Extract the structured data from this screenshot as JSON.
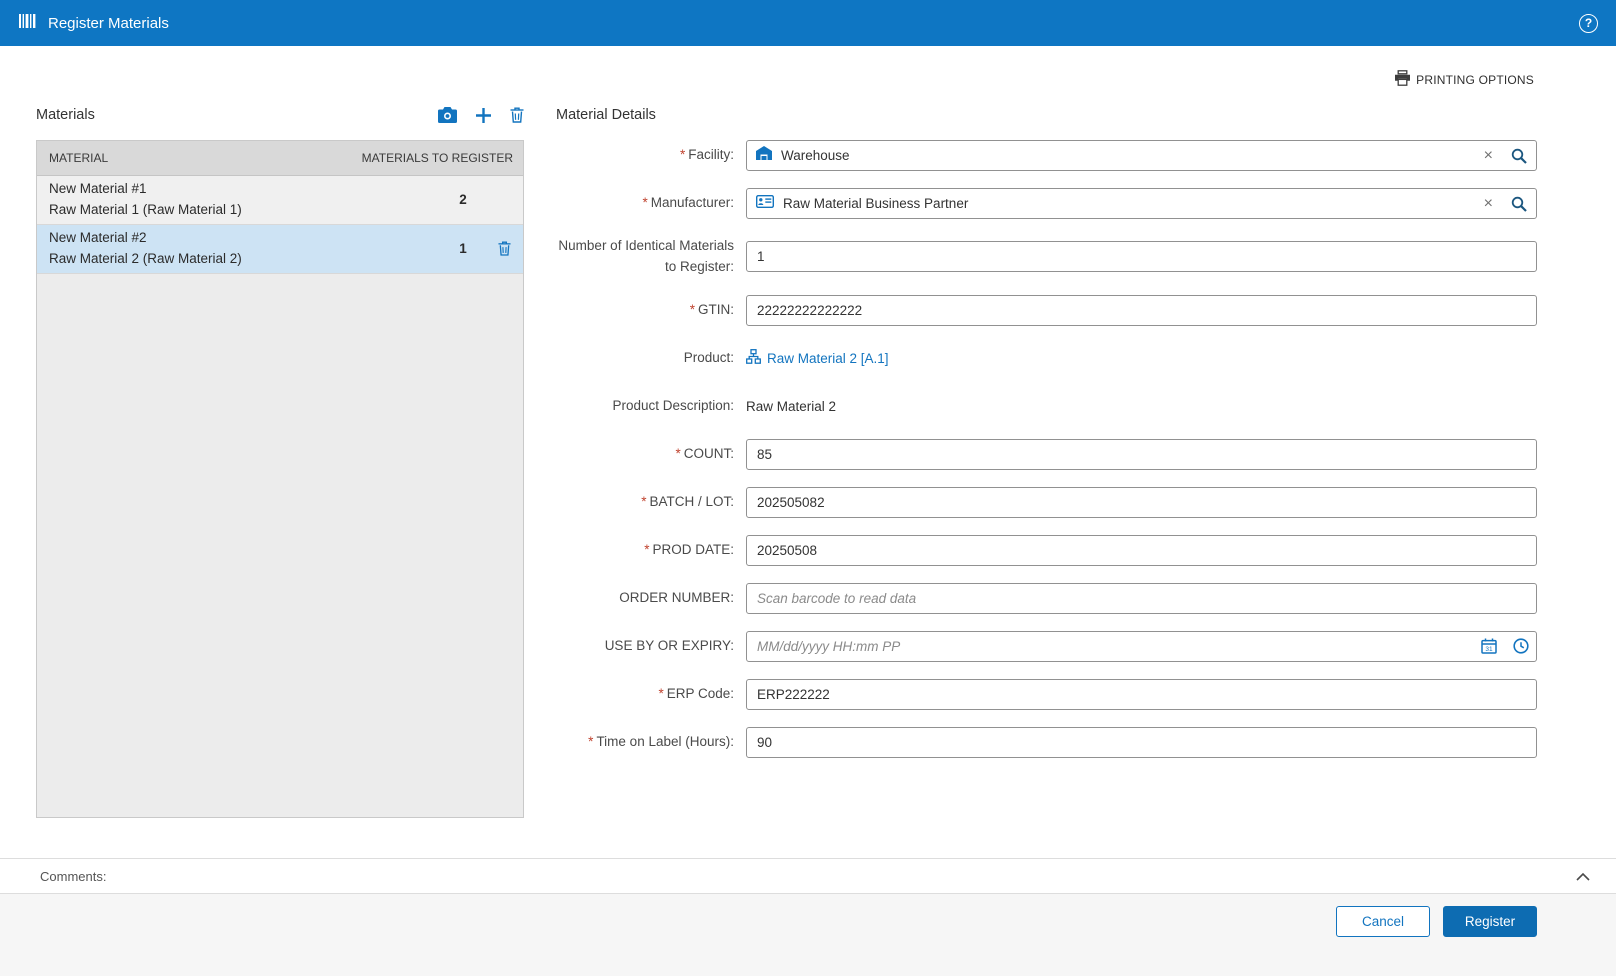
{
  "header": {
    "title": "Register Materials"
  },
  "icons": {
    "help": "?",
    "clear": "×"
  },
  "toolbar": {
    "printing_options_label": "PRINTING OPTIONS"
  },
  "materials_panel": {
    "title": "Materials",
    "columns": {
      "material": "MATERIAL",
      "to_register": "MATERIALS TO REGISTER"
    },
    "rows": [
      {
        "name": "New Material #1",
        "description": "Raw Material 1 (Raw Material 1)",
        "count": "2"
      },
      {
        "name": "New Material #2",
        "description": "Raw Material 2 (Raw Material 2)",
        "count": "1"
      }
    ]
  },
  "details": {
    "title": "Material Details",
    "required_marker": "*",
    "fields": {
      "facility": {
        "label": "Facility:",
        "value": "Warehouse"
      },
      "manufacturer": {
        "label": "Manufacturer:",
        "value": "Raw Material Business Partner"
      },
      "identical": {
        "label": "Number of Identical Materials to Register:",
        "value": "1"
      },
      "gtin": {
        "label": "GTIN:",
        "value": "22222222222222"
      },
      "product": {
        "label": "Product:",
        "link": "Raw Material 2 [A.1]"
      },
      "product_description": {
        "label": "Product Description:",
        "value": "Raw Material 2"
      },
      "count": {
        "label": "COUNT:",
        "value": "85"
      },
      "batch": {
        "label": "BATCH / LOT:",
        "value": "202505082"
      },
      "prod_date": {
        "label": "PROD DATE:",
        "value": "20250508"
      },
      "order_number": {
        "label": "ORDER NUMBER:",
        "placeholder": "Scan barcode to read data"
      },
      "expiry": {
        "label": "USE BY OR EXPIRY:",
        "placeholder": "MM/dd/yyyy HH:mm PP"
      },
      "erp": {
        "label": "ERP Code:",
        "value": "ERP222222"
      },
      "time_on_label": {
        "label": "Time on Label (Hours):",
        "value": "90"
      }
    }
  },
  "comments": {
    "label": "Comments:"
  },
  "footer": {
    "cancel_label": "Cancel",
    "register_label": "Register"
  },
  "colors": {
    "header_bg": "#0e76c3",
    "accent": "#1274bf",
    "link": "#1274bf",
    "required": "#c0432f",
    "selected_row": "#cde3f4",
    "register_button": "#0d6cb2"
  }
}
